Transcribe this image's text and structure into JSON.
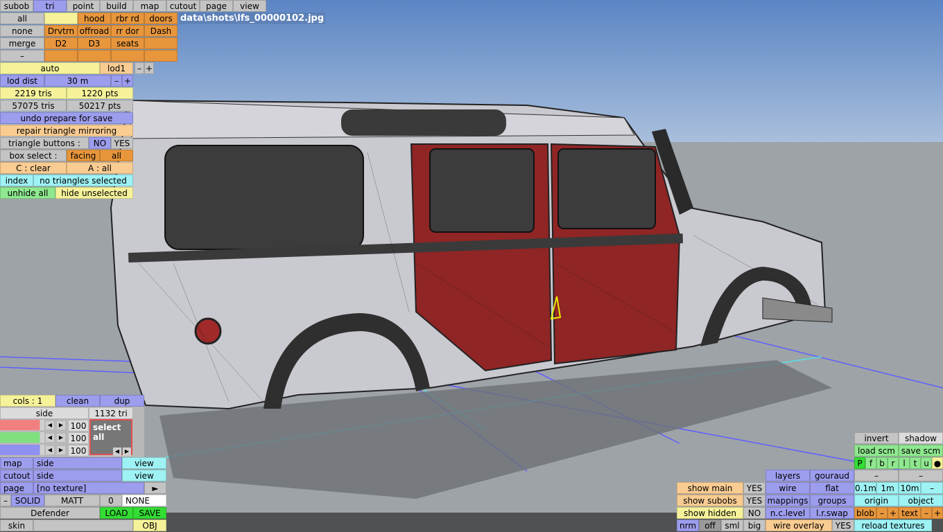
{
  "file_path": "data\\shots\\lfs_00000102.jpg",
  "menu": [
    "subob",
    "tri",
    "point",
    "build",
    "map",
    "cutout",
    "page",
    "view"
  ],
  "sel_buttons": {
    "all": "all",
    "none": "none",
    "merge": "merge",
    "minus": "–",
    "hood": "hood",
    "rbr_rd": "rbr rd",
    "doors": "doors",
    "drvtrn": "Drvtrn",
    "offroad": "offroad",
    "rr_dor": "rr dor",
    "dash": "Dash",
    "d2": "D2",
    "d3": "D3",
    "seats": "seats"
  },
  "lod": {
    "auto": "auto",
    "lod": "lod1",
    "minus": "–",
    "plus": "+",
    "dist_label": "lod dist",
    "dist_value": "30 m"
  },
  "stats": {
    "tris1": "2219 tris",
    "pts1": "1220 pts",
    "tris2": "57075 tris",
    "pts2": "50217 pts"
  },
  "actions": {
    "undo": "undo prepare for save",
    "repair": "repair triangle mirroring",
    "tri_buttons": "triangle buttons :",
    "no": "NO",
    "yes": "YES",
    "box_select": "box select :",
    "facing": "facing",
    "all": "all",
    "c_clear": "C : clear",
    "a_all": "A : all",
    "index": "index",
    "selected": "no triangles selected",
    "unhide": "unhide all",
    "hide_unsel": "hide unselected"
  },
  "colors": {
    "cols": "cols : 1",
    "clean": "clean",
    "dup": "dup",
    "side": "side",
    "tri_count": "1132 tri",
    "v1": "100",
    "v2": "100",
    "v3": "100",
    "select_all": "select all"
  },
  "mapping": {
    "map": "map",
    "map_val": "side",
    "map_view": "view",
    "cutout": "cutout",
    "cutout_val": "side",
    "cutout_view": "view",
    "page": "page",
    "page_val": "[no texture]",
    "page_arrow": "►",
    "minus": "–",
    "solid": "SOLID",
    "matt": "MATT",
    "zero": "0",
    "none": "NONE",
    "name": "Defender",
    "load": "LOAD",
    "save": "SAVE",
    "skin": "skin",
    "obj": "OBJ"
  },
  "right_panel": {
    "invert": "invert",
    "shadow": "shadow",
    "load_scm": "load scm",
    "save_scm": "save scm",
    "letters": [
      "P",
      "f",
      "b",
      "r",
      "l",
      "t",
      "u",
      "●"
    ],
    "layers": "layers",
    "gouraud": "gouraud",
    "dash1": "–",
    "dash2": "–",
    "wire": "wire",
    "flat": "flat",
    "d01": "0.1m",
    "d1": "1m",
    "d10": "10m",
    "dminus": "–",
    "mappings": "mappings",
    "groups": "groups",
    "origin": "origin",
    "object": "object",
    "nclevel": "n.c.level",
    "lrswap": "l.r.swap",
    "blob": "blob",
    "bminus": "–",
    "bplus": "+",
    "text": "text",
    "tminus": "–",
    "tplus": "+",
    "wire_overlay": "wire overlay",
    "wo_yes": "YES",
    "reload": "reload textures",
    "show_main": "show main",
    "sm_yes": "YES",
    "show_subobs": "show subobs",
    "ss_yes": "YES",
    "show_hidden": "show hidden",
    "sh_no": "NO",
    "nrm": "nrm",
    "off": "off",
    "sml": "sml",
    "big": "big"
  }
}
